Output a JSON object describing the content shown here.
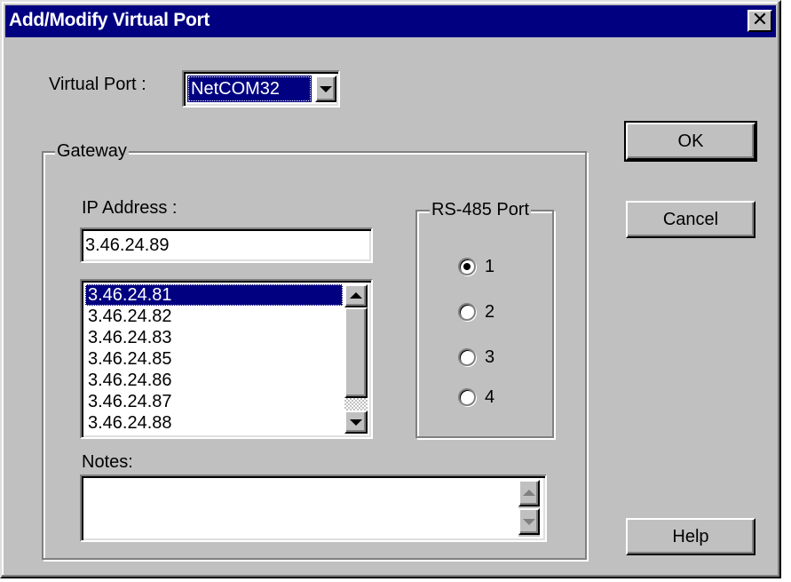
{
  "window": {
    "title": "Add/Modify Virtual Port",
    "close_glyph": "✕"
  },
  "virtual_port": {
    "label": "Virtual Port :",
    "selected": "NetCOM32"
  },
  "gateway": {
    "label": "Gateway",
    "ip_label": "IP Address :",
    "ip_value": "3.46.24.89",
    "ip_list": [
      "3.46.24.81",
      "3.46.24.82",
      "3.46.24.83",
      "3.46.24.85",
      "3.46.24.86",
      "3.46.24.87",
      "3.46.24.88"
    ],
    "selected_ip": "3.46.24.81",
    "rs485": {
      "label": "RS-485 Port",
      "options": [
        "1",
        "2",
        "3",
        "4"
      ],
      "selected": "1"
    },
    "notes_label": "Notes:",
    "notes_value": ""
  },
  "buttons": {
    "ok": "OK",
    "cancel": "Cancel",
    "help": "Help"
  },
  "icons": {
    "dropdown": "chevron-down-icon",
    "scroll_up": "scroll-up-icon",
    "scroll_down": "scroll-down-icon",
    "close": "close-icon"
  }
}
